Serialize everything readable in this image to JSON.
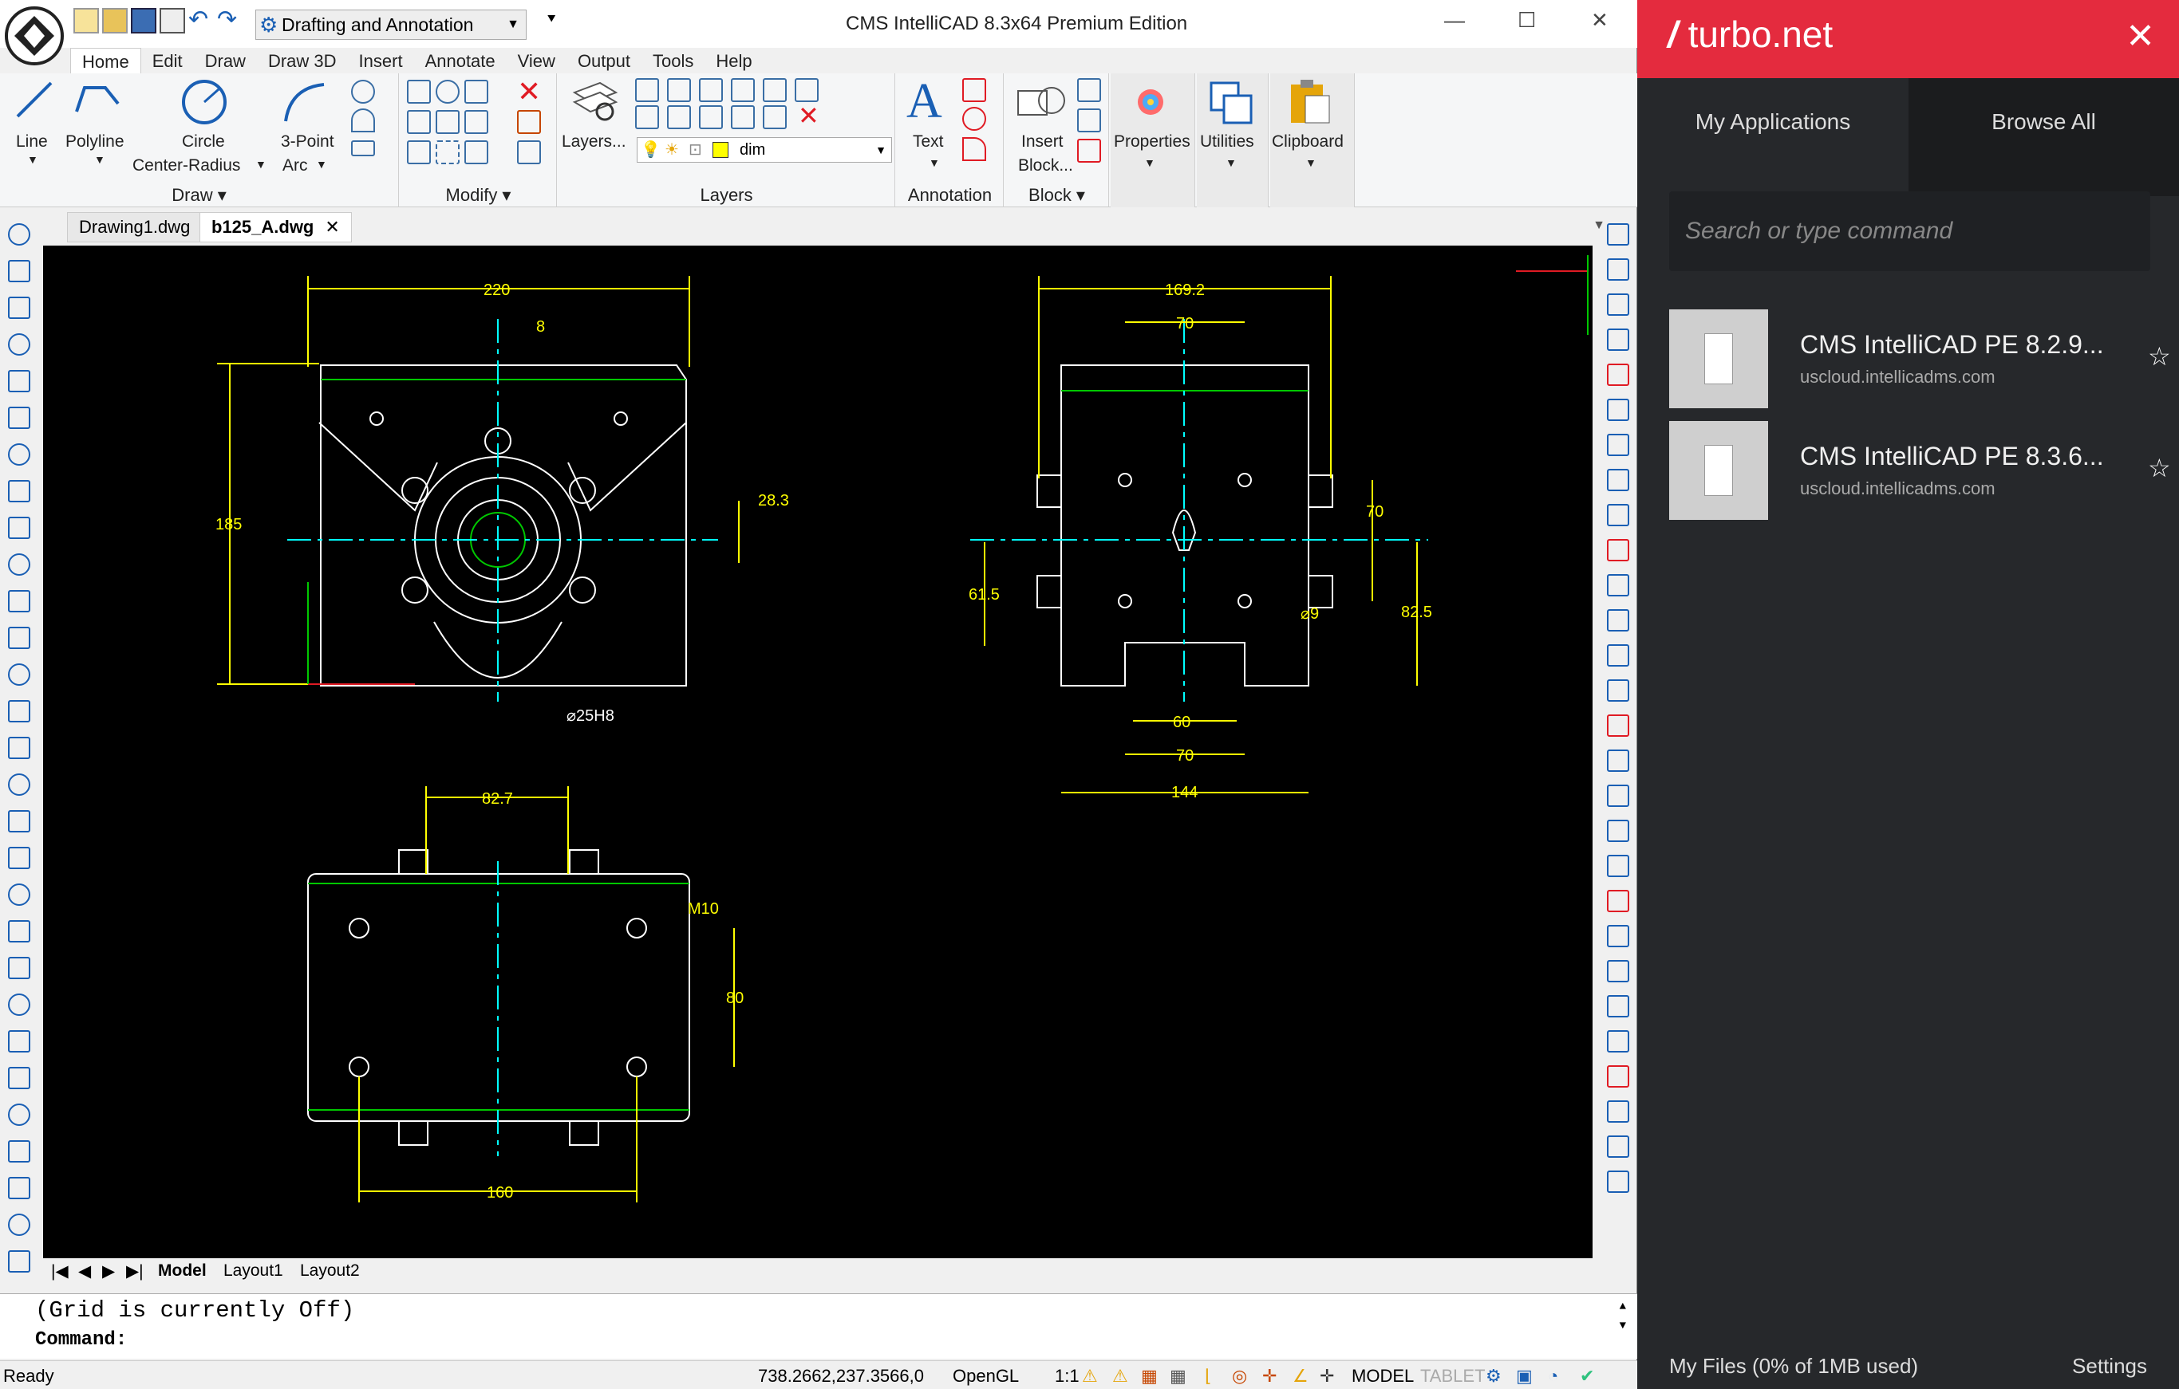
{
  "window": {
    "title": "CMS IntelliCAD 8.3x64 Premium Edition",
    "workspace": "Drafting and Annotation",
    "minimize": "—",
    "maximize": "☐",
    "close": "✕"
  },
  "menu": [
    "Home",
    "Edit",
    "Draw",
    "Draw 3D",
    "Insert",
    "Annotate",
    "View",
    "Output",
    "Tools",
    "Help"
  ],
  "ribbon": {
    "draw": {
      "line": "Line",
      "polyline": "Polyline",
      "circle": "Circle",
      "circle_sub": "Center-Radius",
      "arc": "3-Point",
      "arc_sub": "Arc",
      "group": "Draw"
    },
    "modify": {
      "group": "Modify"
    },
    "layers": {
      "layers_btn": "Layers...",
      "current_layer": "dim",
      "group": "Layers"
    },
    "annotation": {
      "text": "Text",
      "group": "Annotation"
    },
    "block": {
      "insert": "Insert",
      "insert_sub": "Block...",
      "group": "Block"
    },
    "properties": "Properties",
    "utilities": "Utilities",
    "clipboard": "Clipboard"
  },
  "doc_tabs": [
    "Drawing1.dwg",
    "b125_A.dwg"
  ],
  "layout_tabs": [
    "Model",
    "Layout1",
    "Layout2"
  ],
  "drawing": {
    "front": {
      "d_width": "220",
      "d_off": "8",
      "d_height": "185",
      "d_r": "28.3",
      "d_bore": "⌀25H8"
    },
    "side": {
      "d_width": "169.2",
      "d_top": "70",
      "d_h1": "70",
      "d_h2": "61.5",
      "d_h3": "82.5",
      "d_hole": "⌀9",
      "d_b1": "60",
      "d_b2": "70",
      "d_b3": "144"
    },
    "top": {
      "d_top": "82.7",
      "d_thread": "M10",
      "d_v": "80",
      "d_bottom": "160"
    }
  },
  "command": {
    "history": "(Grid is currently Off)",
    "prompt": "Command:"
  },
  "status": {
    "ready": "Ready",
    "coords": "738.2662,237.3566,0",
    "renderer": "OpenGL",
    "scale": "1:1",
    "model": "MODEL",
    "tablet": "TABLET"
  },
  "turbo": {
    "brand": "turbo.net",
    "close": "✕",
    "tabs": [
      "My Applications",
      "Browse All"
    ],
    "search_placeholder": "Search or type command",
    "apps": [
      {
        "name": "CMS IntelliCAD PE 8.2.9...",
        "host": "uscloud.intellicadms.com"
      },
      {
        "name": "CMS IntelliCAD PE 8.3.6...",
        "host": "uscloud.intellicadms.com"
      }
    ],
    "files": "My Files (0% of 1MB used)",
    "settings": "Settings"
  },
  "colors": {
    "accent": "#e42b3e",
    "cad_yellow": "#ffff00",
    "cad_cyan": "#00ffff",
    "cad_green": "#00c800"
  }
}
